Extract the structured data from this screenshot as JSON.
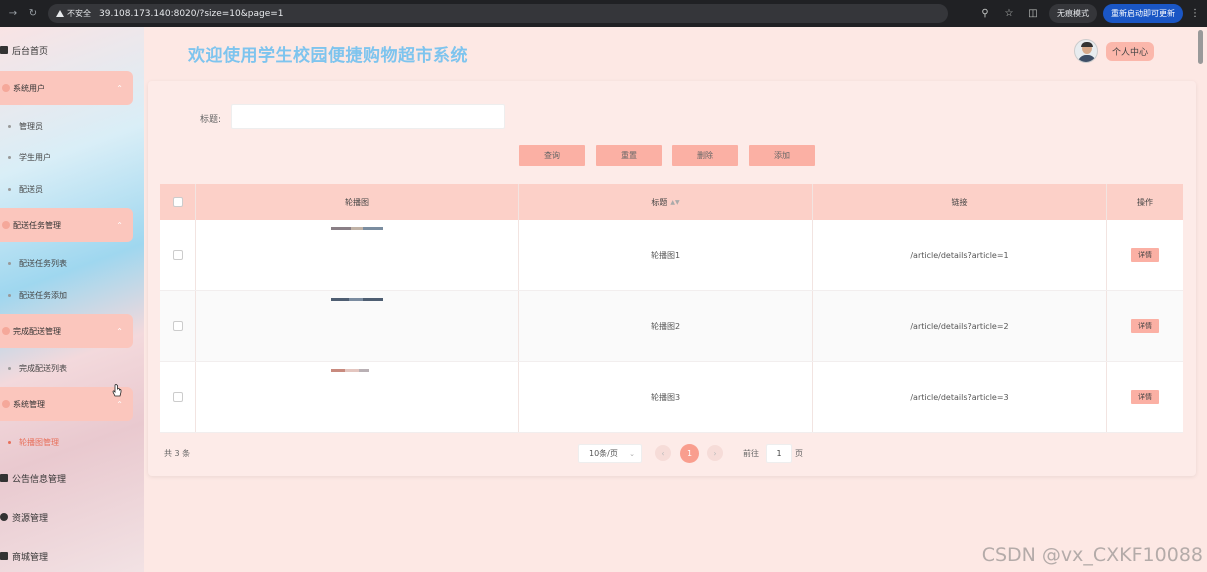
{
  "browser": {
    "insecure_label": "不安全",
    "url": "39.108.173.140:8020/?size=10&page=1",
    "incognito_label": "无痕模式",
    "update_label": "重新启动即可更新"
  },
  "sidebar": {
    "home": "后台首页",
    "groups": [
      {
        "label": "系统用户",
        "items": [
          "管理员",
          "学生用户",
          "配送员"
        ]
      },
      {
        "label": "配送任务管理",
        "items": [
          "配送任务列表",
          "配送任务添加"
        ]
      },
      {
        "label": "完成配送管理",
        "items": [
          "完成配送列表"
        ]
      },
      {
        "label": "系统管理",
        "items": [
          "轮播图管理"
        ]
      }
    ],
    "bottom": [
      "公告信息管理",
      "资源管理",
      "商城管理"
    ]
  },
  "header": {
    "title": "欢迎使用学生校园便捷购物超市系统",
    "profile_label": "个人中心"
  },
  "search": {
    "label": "标题:",
    "value": ""
  },
  "actions": {
    "query": "查询",
    "reset": "重置",
    "delete": "删除",
    "add": "添加"
  },
  "table": {
    "columns": [
      "轮播图",
      "标题",
      "链接",
      "操作"
    ],
    "rows": [
      {
        "title": "轮播图1",
        "link": "/article/details?article=1",
        "action": "详情"
      },
      {
        "title": "轮播图2",
        "link": "/article/details?article=2",
        "action": "详情"
      },
      {
        "title": "轮播图3",
        "link": "/article/details?article=3",
        "action": "详情"
      }
    ]
  },
  "pagination": {
    "total": "共 3 条",
    "page_size": "10条/页",
    "current_page": "1",
    "goto_label": "前往",
    "goto_value": "1",
    "goto_suffix": "页"
  },
  "watermark": "CSDN @vx_CXKF10088",
  "colors": {
    "accent": "#fbb0a4",
    "title": "#7ec4ee",
    "header_row": "#fcd0c8"
  }
}
